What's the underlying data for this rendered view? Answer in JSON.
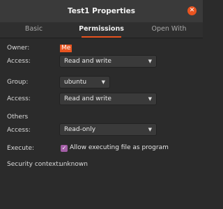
{
  "window": {
    "title": "Test1 Properties"
  },
  "tabs": [
    "Basic",
    "Permissions",
    "Open With"
  ],
  "owner": {
    "label": "Owner:",
    "value": "Me",
    "access_label": "Access:",
    "access_value": "Read and write"
  },
  "group": {
    "label": "Group:",
    "value": "ubuntu",
    "access_label": "Access:",
    "access_value": "Read and write"
  },
  "others": {
    "label": "Others",
    "access_label": "Access:",
    "access_value": "Read-only"
  },
  "execute": {
    "label": "Execute:",
    "checkbox_label": "Allow executing file as program",
    "checked": true
  },
  "security": {
    "label": "Security context:",
    "value": "unknown"
  },
  "colors": {
    "accent": "#e95420",
    "checkbox": "#a35ea6",
    "background": "#2b2b2b"
  },
  "icons": {
    "close": "close-icon",
    "dropdown": "chevron-down-icon",
    "check": "check-icon"
  }
}
